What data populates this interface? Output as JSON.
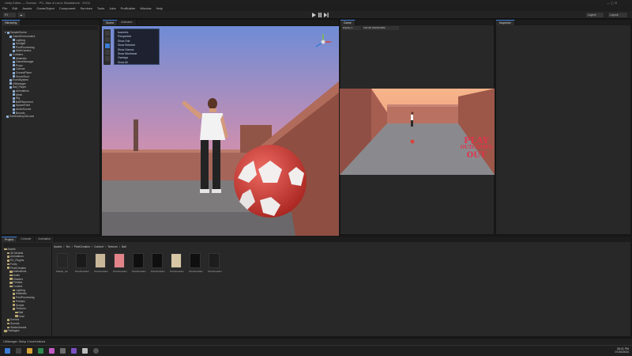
{
  "window": {
    "title": "Unity Editor — Scenes · PC, Mac & Linux Standalone · DX11"
  },
  "menu": [
    "File",
    "Edit",
    "Assets",
    "GameObject",
    "Component",
    "Services",
    "Tools",
    "Jobs",
    "ProBuilder",
    "Window",
    "Help"
  ],
  "toolbar": {
    "account": "PJ",
    "layers": "Layers",
    "layout": "Layout"
  },
  "hierarchy": {
    "tab": "Hierarchy",
    "scene": "SampleScene",
    "items": [
      {
        "label": "GameEnvironment",
        "indent": 1
      },
      {
        "label": "Lighting",
        "indent": 2
      },
      {
        "label": "Sunlight",
        "indent": 2
      },
      {
        "label": "PostProcessing",
        "indent": 2
      },
      {
        "label": "MainCamera",
        "indent": 2
      },
      {
        "label": "Colliders",
        "indent": 1
      },
      {
        "label": "Materials",
        "indent": 2
      },
      {
        "label": "GameManager",
        "indent": 2
      },
      {
        "label": "Props",
        "indent": 2
      },
      {
        "label": "Canvas",
        "indent": 2
      },
      {
        "label": "GroundPlane",
        "indent": 2
      },
      {
        "label": "SceneRoot",
        "indent": 2
      },
      {
        "label": "EventSystem",
        "indent": 1
      },
      {
        "label": "UIManager",
        "indent": 1
      },
      {
        "label": "Ball_Player",
        "indent": 1
      },
      {
        "label": "Animations",
        "indent": 2
      },
      {
        "label": "Mesh",
        "indent": 2
      },
      {
        "label": "Rig",
        "indent": 2
      },
      {
        "label": "BallPlacement",
        "indent": 2
      },
      {
        "label": "SpawnPoint",
        "indent": 2
      },
      {
        "label": "AudioSource",
        "indent": 2
      },
      {
        "label": "Bounds",
        "indent": 2
      },
      {
        "label": "DontDestroyOnLoad",
        "indent": 0
      }
    ]
  },
  "scene_view": {
    "tabs": [
      "Scene",
      "Animator"
    ],
    "dropdown": [
      "Isometric",
      "Perspective",
      "Show Grid",
      "Show Selected",
      "Show Gizmos",
      "Show Wireframe",
      "Overlays",
      "Show All"
    ]
  },
  "game_view": {
    "tabs": [
      "Game"
    ],
    "display": "Display 1",
    "aspect": "Full HD (1920x1080)",
    "overlay": [
      "PLAY",
      "OUTCOMES",
      "OUT"
    ]
  },
  "inspector": {
    "tab": "Inspector"
  },
  "project": {
    "tabs": [
      "Project",
      "Console",
      "Animation"
    ],
    "breadcrumb": [
      "Assets",
      "Tex",
      "PixelCreation",
      "Content",
      "Textures",
      "Ball"
    ],
    "tree": [
      {
        "label": "Assets",
        "indent": 0
      },
      {
        "label": "3D Models",
        "indent": 1
      },
      {
        "label": "Animations",
        "indent": 1
      },
      {
        "label": "EZ_Plugins",
        "indent": 1
      },
      {
        "label": "Fonts",
        "indent": 1
      },
      {
        "label": "PixelCreation",
        "indent": 1
      },
      {
        "label": "Animations",
        "indent": 2
      },
      {
        "label": "Audio",
        "indent": 2
      },
      {
        "label": "Shaders",
        "indent": 2
      },
      {
        "label": "Prefabs",
        "indent": 2
      },
      {
        "label": "Content",
        "indent": 2
      },
      {
        "label": "Lighting",
        "indent": 3
      },
      {
        "label": "Materials",
        "indent": 3
      },
      {
        "label": "PostProcessing",
        "indent": 3
      },
      {
        "label": "Prefabs",
        "indent": 3
      },
      {
        "label": "Scripts",
        "indent": 3
      },
      {
        "label": "Textures",
        "indent": 3
      },
      {
        "label": "Ball",
        "indent": 4
      },
      {
        "label": "Goal",
        "indent": 4
      },
      {
        "label": "Scenes",
        "indent": 1
      },
      {
        "label": "Sounds",
        "indent": 1
      },
      {
        "label": "StarterAssets",
        "indent": 1
      },
      {
        "label": "Packages",
        "indent": 0
      }
    ],
    "assets": [
      "Palette_tex",
      "PixelCreation",
      "PixelCreation",
      "PixelCreation",
      "PixelCreation",
      "PixelCreation",
      "PixelCreation",
      "PixelCreation",
      "PixelCreation"
    ]
  },
  "status": {
    "text": "UIManager: Setup 4 level buttons"
  },
  "taskbar": {
    "time": "08:41 PM",
    "date": "07/20/2024"
  },
  "colors": {
    "accent": "#3a7bd5",
    "sky_top": "#6f8cd6",
    "sky_bottom": "#e9a49a",
    "wall": "#9b5a4d",
    "ball": "#d8433f",
    "overlay_text": "#e1344c"
  }
}
